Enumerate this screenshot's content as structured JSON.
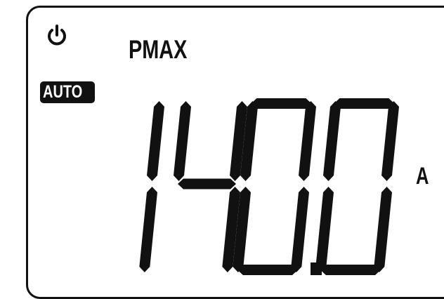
{
  "display": {
    "power_icon": "power-icon",
    "mode": "PMAX",
    "range_badge": "AUTO",
    "reading": "140.0",
    "unit": "A"
  },
  "colors": {
    "segment": "#111111",
    "background": "#ffffff"
  }
}
